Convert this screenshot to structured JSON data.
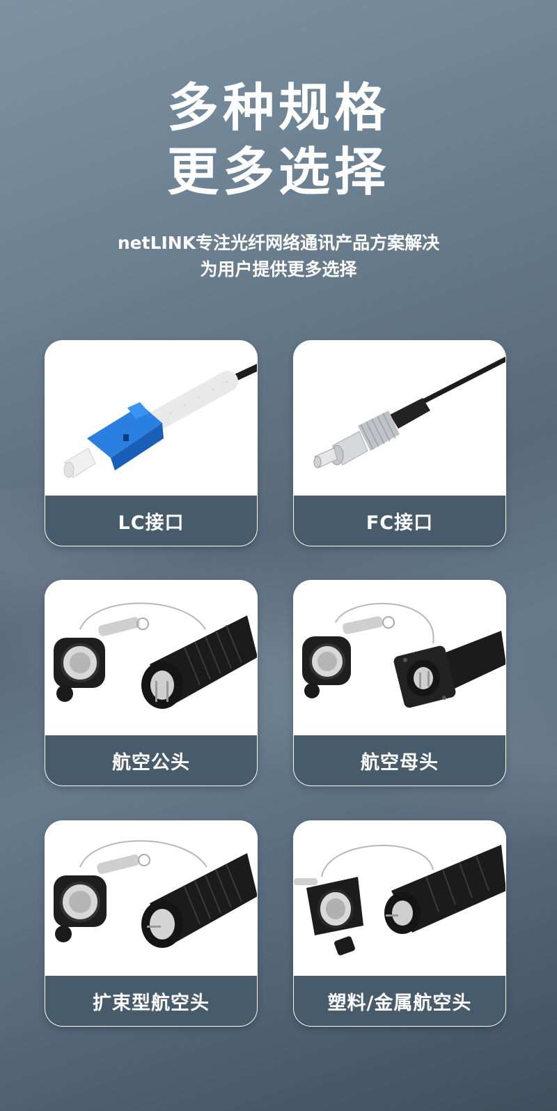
{
  "heading": {
    "line1": "多种规格",
    "line2": "更多选择"
  },
  "subtitle": {
    "line1": "netLINK专注光纤网络通讯产品方案解决",
    "line2": "为用户提供更多选择"
  },
  "products": [
    {
      "label": "LC接口",
      "icon": "lc-connector-image"
    },
    {
      "label": "FC接口",
      "icon": "fc-connector-image"
    },
    {
      "label": "航空公头",
      "icon": "aviation-male-connector-image"
    },
    {
      "label": "航空母头",
      "icon": "aviation-female-connector-image"
    },
    {
      "label": "扩束型航空头",
      "icon": "expanded-beam-connector-image"
    },
    {
      "label": "塑料/金属航空头",
      "icon": "plastic-metal-connector-image"
    }
  ],
  "colors": {
    "label_bar": "#485b6b",
    "lc_blue": "#2a7fe0"
  }
}
